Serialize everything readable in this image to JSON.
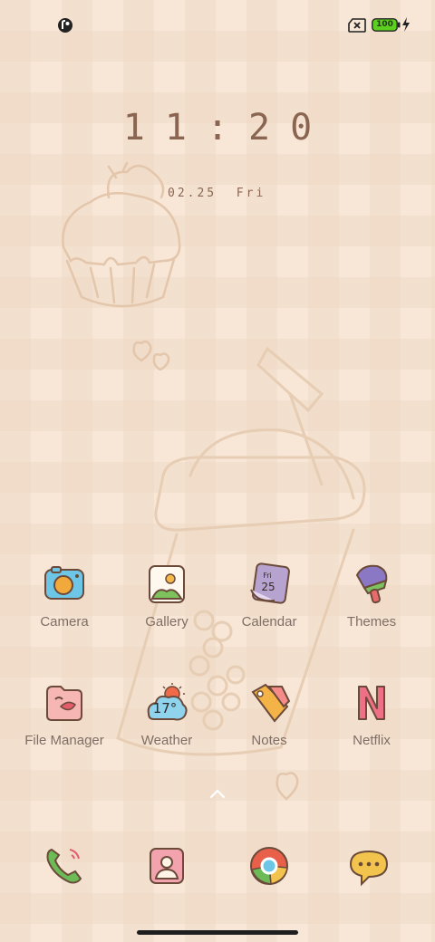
{
  "status_bar": {
    "battery_level": "100",
    "left_icon": "notification-app-icon",
    "sim_icon": "no-sim-icon",
    "charging_icon": "charging-bolt-icon",
    "battery_color": "#5cd01f"
  },
  "lock_clock": {
    "time": "11:20",
    "date": "02.25",
    "weekday": "Fri"
  },
  "apps": [
    {
      "label": "Camera",
      "icon": "camera-icon"
    },
    {
      "label": "Gallery",
      "icon": "gallery-icon"
    },
    {
      "label": "Calendar",
      "icon": "calendar-icon",
      "icon_text_day": "Fri",
      "icon_text_date": "25"
    },
    {
      "label": "Themes",
      "icon": "themes-icon"
    },
    {
      "label": "File Manager",
      "icon": "file-manager-icon"
    },
    {
      "label": "Weather",
      "icon": "weather-icon",
      "icon_text_temp": "17°"
    },
    {
      "label": "Notes",
      "icon": "notes-icon"
    },
    {
      "label": "Netflix",
      "icon": "netflix-icon"
    }
  ],
  "dock": [
    {
      "icon": "phone-icon"
    },
    {
      "icon": "contacts-icon"
    },
    {
      "icon": "browser-icon"
    },
    {
      "icon": "messages-icon"
    }
  ],
  "colors": {
    "background": "#f8e6d7",
    "text_label": "#7f6e65",
    "clock": "#8a6652"
  }
}
